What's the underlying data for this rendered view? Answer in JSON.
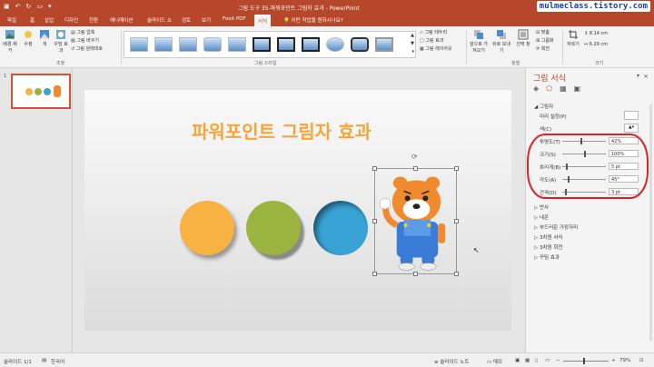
{
  "window": {
    "title": "그림 도구  35-파워포인트 그림자 효과 - PowerPoint"
  },
  "watermark": "mulmeclass.tistory.com",
  "tabs": [
    "파일",
    "홈",
    "삽입",
    "디자인",
    "전환",
    "애니메이션",
    "슬라이드 쇼",
    "검토",
    "보기",
    "Foxit PDF",
    "서식"
  ],
  "tell_me": "어떤 작업을 원하시나요?",
  "ribbon": {
    "remove_bg": "배경 제거",
    "corrections": "수정",
    "color": "색",
    "artistic": "꾸밈 효과",
    "compress": "그림 압축",
    "change": "그림 바꾸기",
    "reset": "그림 원래대로",
    "adjust_label": "조정",
    "styles_label": "그림 스타일",
    "border": "그림 테두리",
    "effects": "그림 효과",
    "layout": "그림 레이아웃",
    "bring_forward": "앞으로 가져오기",
    "send_backward": "뒤로 보내기",
    "selection_pane": "선택 창",
    "align": "맞춤",
    "group": "그룹화",
    "rotate": "회전",
    "arrange_label": "정렬",
    "crop": "자르기",
    "height": "8.14 cm",
    "width": "6.29 cm",
    "size_label": "크기"
  },
  "slide_panel": {
    "number": "1"
  },
  "slide": {
    "title": "파워포인트 그림자 효과"
  },
  "circles": {
    "orange": "#f7b241",
    "green": "#9bb33f",
    "blue": "#3aa3d6"
  },
  "format_panel": {
    "title": "그림 서식",
    "close": "×",
    "shadow_header": "그림자",
    "preset": "미리 설정(P)",
    "color": "색(C)",
    "transparency_label": "투명도(T)",
    "transparency_value": "42%",
    "size_label": "크기(S)",
    "size_value": "100%",
    "blur_label": "흐리게(B)",
    "blur_value": "5 pt",
    "angle_label": "각도(A)",
    "angle_value": "45°",
    "distance_label": "간격(D)",
    "distance_value": "3 pt",
    "sections": [
      "반사",
      "네온",
      "부드러운 가장자리",
      "3차원 서식",
      "3차원 회전",
      "꾸밈 효과"
    ]
  },
  "status": {
    "slide_info": "슬라이드 1/1",
    "language": "한국어",
    "notes": "슬라이드 노트",
    "comments": "메모",
    "zoom": "79%"
  }
}
